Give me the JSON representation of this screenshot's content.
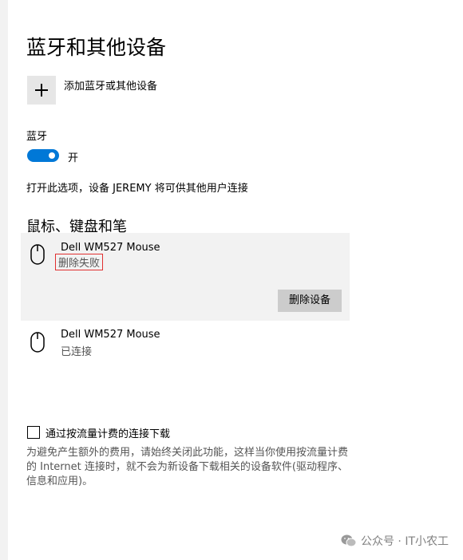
{
  "page": {
    "title": "蓝牙和其他设备"
  },
  "add_device": {
    "label": "添加蓝牙或其他设备",
    "icon": "plus-icon"
  },
  "bluetooth": {
    "heading": "蓝牙",
    "toggle_state": "开",
    "toggle_on": true,
    "accent_color": "#0078d7",
    "description": "打开此选项，设备 JEREMY 将可供其他用户连接"
  },
  "mouse_section": {
    "title": "鼠标、键盘和笔",
    "devices": [
      {
        "name": "Dell WM527 Mouse",
        "status": "删除失败",
        "icon": "mouse-icon",
        "remove_label": "删除设备"
      },
      {
        "name": "Dell WM527 Mouse",
        "status": "已连接",
        "icon": "mouse-icon"
      }
    ]
  },
  "metered": {
    "checkbox_label": "通过按流量计费的连接下载",
    "checked": false,
    "description": "为避免产生额外的费用，请始终关闭此功能，这样当你使用按流量计费的 Internet 连接时，就不会为新设备下载相关的设备软件(驱动程序、信息和应用)。"
  },
  "watermark": {
    "text": "公众号 · IT小农工",
    "icon": "wechat-icon"
  }
}
